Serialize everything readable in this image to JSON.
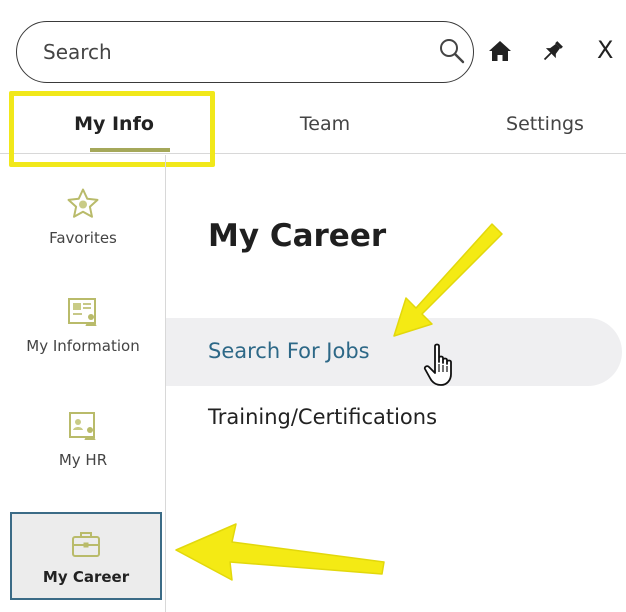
{
  "search": {
    "placeholder": "Search"
  },
  "topbar": {
    "close_glyph": "X"
  },
  "tabs": [
    {
      "label": "My Info",
      "active": true
    },
    {
      "label": "Team"
    },
    {
      "label": "Settings"
    }
  ],
  "sidebar": {
    "items": [
      {
        "label": "Favorites",
        "icon": "star-icon"
      },
      {
        "label": "My Information",
        "icon": "id-card-icon"
      },
      {
        "label": "My HR",
        "icon": "hr-doc-icon"
      },
      {
        "label": "My Career",
        "icon": "briefcase-icon",
        "active": true
      }
    ]
  },
  "main": {
    "title": "My Career",
    "links": [
      {
        "label": "Search For Jobs",
        "active": true
      },
      {
        "label": "Training/Certifications"
      }
    ]
  },
  "colors": {
    "accent": "#a5a85a",
    "highlight": "#f1e81a",
    "link": "#2d6887",
    "active_border": "#3b6b86",
    "icon": "#b9bb6a"
  }
}
